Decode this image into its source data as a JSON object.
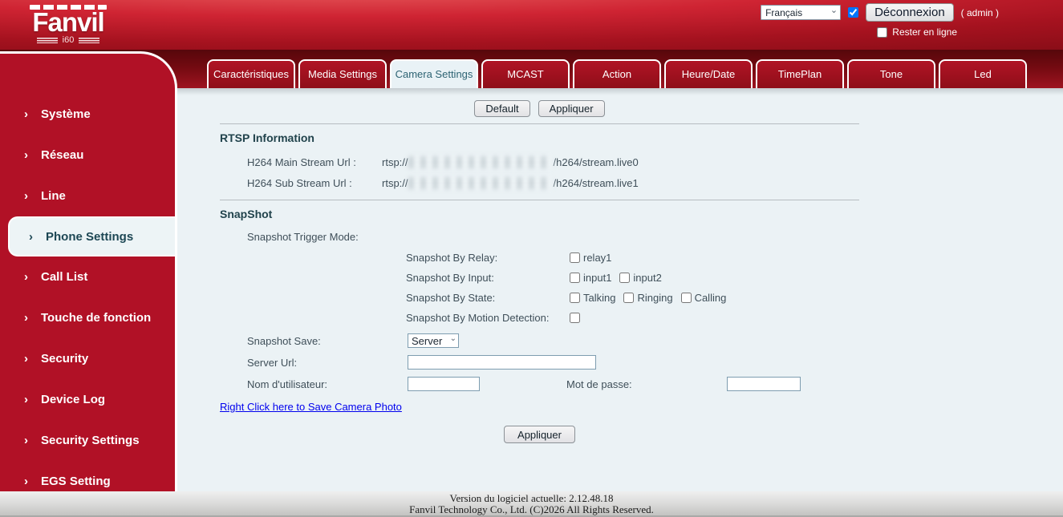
{
  "brand": {
    "name": "Fanvil",
    "model": "i60"
  },
  "header": {
    "language_value": "Français",
    "logout_label": "Déconnexion",
    "admin_label": "( admin )",
    "keep_online_label": "Rester en ligne"
  },
  "tabs": [
    {
      "label": "Caractéristiques",
      "active": false
    },
    {
      "label": "Media Settings",
      "active": false
    },
    {
      "label": "Camera Settings",
      "active": true
    },
    {
      "label": "MCAST",
      "active": false
    },
    {
      "label": "Action",
      "active": false
    },
    {
      "label": "Heure/Date",
      "active": false
    },
    {
      "label": "TimePlan",
      "active": false
    },
    {
      "label": "Tone",
      "active": false
    },
    {
      "label": "Led",
      "active": false
    }
  ],
  "sidebar": [
    {
      "label": "Système",
      "active": false
    },
    {
      "label": "Réseau",
      "active": false
    },
    {
      "label": "Line",
      "active": false
    },
    {
      "label": "Phone Settings",
      "active": true
    },
    {
      "label": "Call List",
      "active": false
    },
    {
      "label": "Touche de fonction",
      "active": false
    },
    {
      "label": "Security",
      "active": false
    },
    {
      "label": "Device Log",
      "active": false
    },
    {
      "label": "Security Settings",
      "active": false
    },
    {
      "label": "EGS Setting",
      "active": false
    }
  ],
  "toolbar": {
    "default_label": "Default",
    "apply_label": "Appliquer"
  },
  "rtsp": {
    "title": "RTSP Information",
    "main_label": "H264 Main Stream Url :",
    "main_prefix": "rtsp://",
    "main_suffix": "/h264/stream.live0",
    "sub_label": "H264 Sub Stream Url :",
    "sub_prefix": "rtsp://",
    "sub_suffix": "/h264/stream.live1"
  },
  "snapshot": {
    "title": "SnapShot",
    "trigger_label": "Snapshot Trigger Mode:",
    "relay_label": "Snapshot By Relay:",
    "relay_option": "relay1",
    "input_label": "Snapshot By Input:",
    "input_option1": "input1",
    "input_option2": "input2",
    "state_label": "Snapshot By State:",
    "state_option1": "Talking",
    "state_option2": "Ringing",
    "state_option3": "Calling",
    "motion_label": "Snapshot By Motion Detection:",
    "save_label": "Snapshot Save:",
    "save_value": "Server",
    "server_url_label": "Server Url:",
    "server_url_value": "",
    "username_label": "Nom d'utilisateur:",
    "username_value": "",
    "password_label": "Mot de passe:",
    "password_value": "",
    "photo_link": "Right Click here to Save Camera Photo",
    "apply_label": "Appliquer"
  },
  "footer": {
    "version": "Version du logiciel actuelle: 2.12.48.18",
    "copyright": "Fanvil Technology Co., Ltd. (C)2026 All Rights Reserved."
  },
  "colors": {
    "header_red": "#a5121f",
    "tab_red": "#a01320",
    "sidebar_red": "#b11126",
    "active_bg": "#edf4f6",
    "active_text": "#2d6373",
    "link_blue": "#0000ee"
  }
}
